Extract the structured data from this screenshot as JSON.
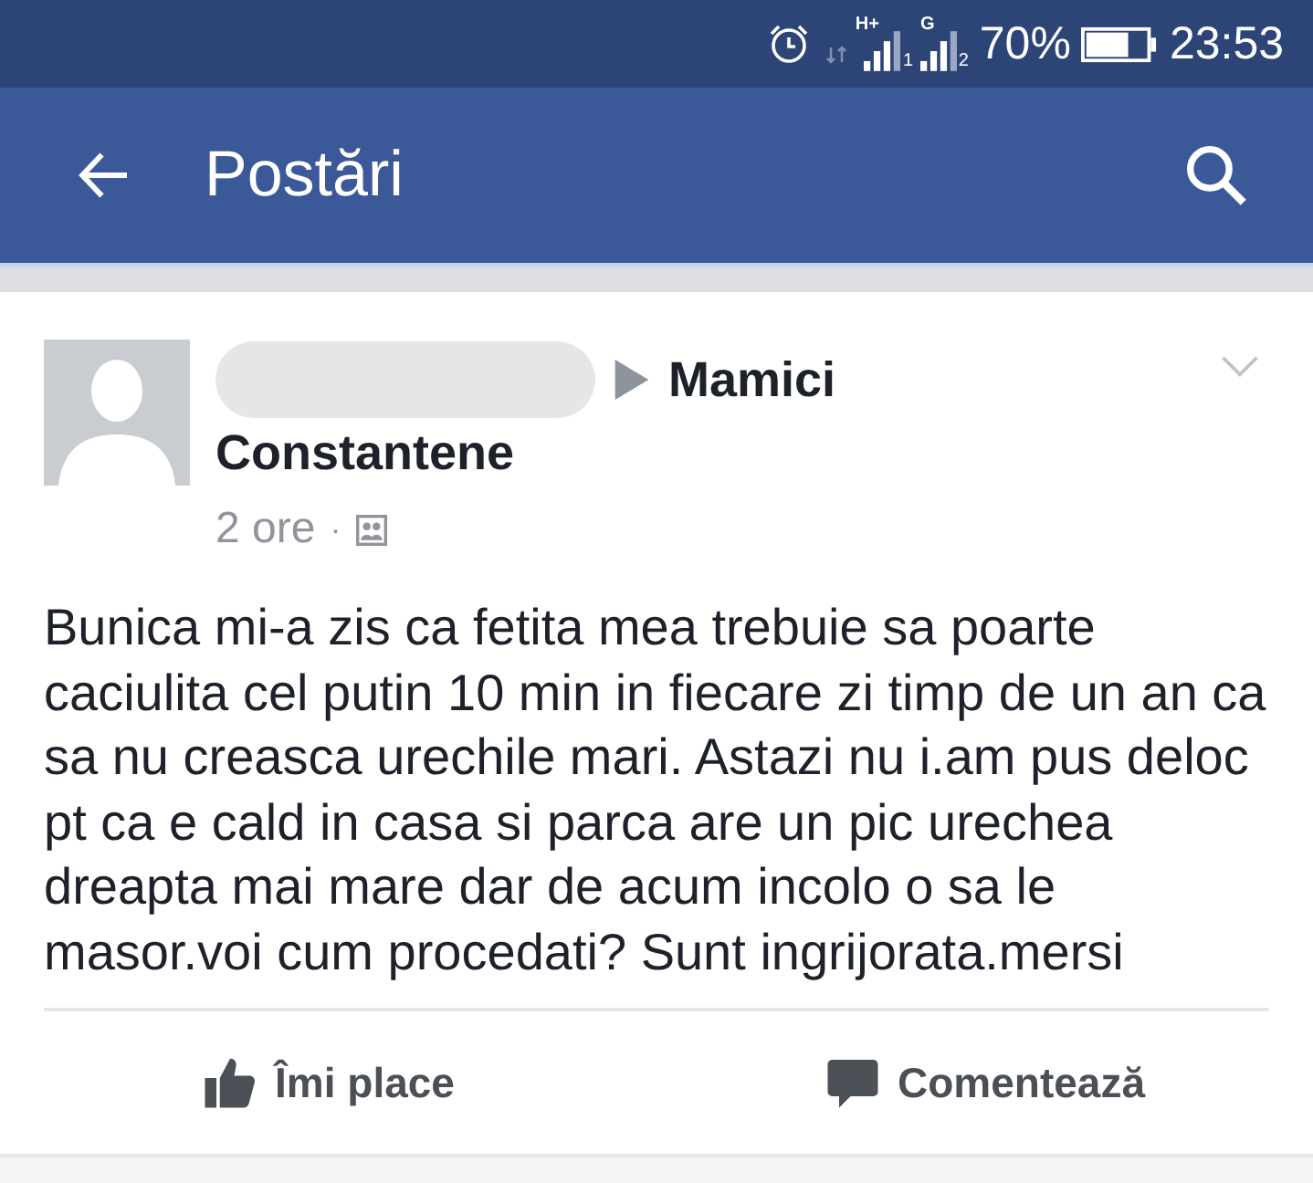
{
  "status_bar": {
    "signals": [
      {
        "network": "H+",
        "sim": "1"
      },
      {
        "network": "G",
        "sim": "2"
      }
    ],
    "battery": "70%",
    "time": "23:53"
  },
  "app_bar": {
    "title": "Postări"
  },
  "post": {
    "author_hidden": true,
    "group_name_lines": [
      "Mamici",
      "Constantene"
    ],
    "time": "2 ore",
    "separator": "·",
    "text": "Bunica mi-a zis ca fetita mea trebuie sa poarte caciulita cel putin 10 min in fiecare zi timp de un an ca sa nu creasca urechile mari. Astazi nu i.am pus deloc pt ca e cald in casa si parca are un pic urechea dreapta mai mare dar de acum incolo o sa le masor.voi cum procedati? Sunt ingrijorata.mersi",
    "actions": [
      {
        "kind": "like",
        "label": "Îmi place"
      },
      {
        "kind": "comment",
        "label": "Comentează"
      }
    ]
  }
}
